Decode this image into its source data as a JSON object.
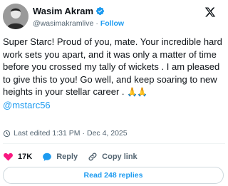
{
  "author": {
    "display_name": "Wasim Akram",
    "handle": "@wasimakramlive",
    "separator": "·",
    "follow_label": "Follow",
    "verified": true,
    "verified_color": "#1d9bf0"
  },
  "tweet": {
    "text": "Super Starc! Proud of you, mate. Your incredible hard work sets you apart, and it was only a matter of time before you crossed my tally of wickets . I am pleased to give this to you! Go well, and keep soaring to new heights in your stellar career . ",
    "emoji": "🙏🙏",
    "mention": "@mstarc56"
  },
  "meta": {
    "edited_label": "Last edited",
    "time": "1:31 PM",
    "separator": "·",
    "date": "Dec 4, 2025"
  },
  "actions": {
    "like_count": "17K",
    "reply_label": "Reply",
    "copy_label": "Copy link"
  },
  "read_replies_label": "Read 248 replies",
  "colors": {
    "accent": "#1d9bf0",
    "like": "#f91880",
    "text_primary": "#0f1419",
    "text_secondary": "#536471",
    "border": "#cfd9de"
  },
  "icons": [
    "verified-badge-icon",
    "x-logo-icon",
    "clock-icon",
    "heart-icon",
    "reply-bubble-icon",
    "link-icon"
  ]
}
